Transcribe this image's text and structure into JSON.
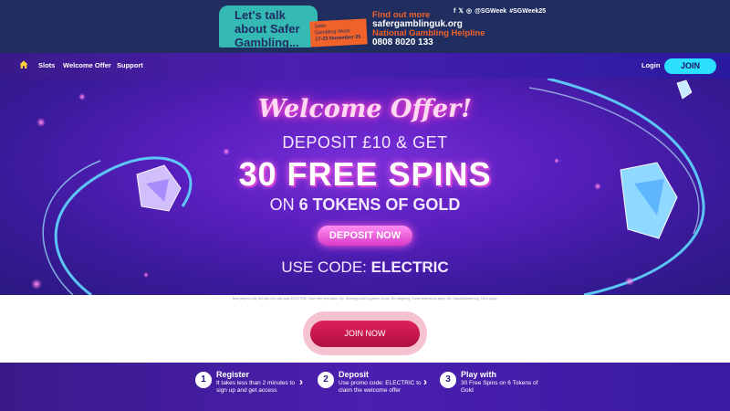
{
  "promo": {
    "bubble_text": "Let's talk about Safer Gambling...",
    "week_line1": "Safer",
    "week_line2": "Gambling Week",
    "week_dates": "17-23 November 25",
    "find_out": "Find out more",
    "site": "safergamblinguk.org",
    "helpline": "National Gambling Helpline",
    "phone": "0808 8020 133",
    "social_handle": "@SGWeek",
    "hashtag": "#SGWeek25",
    "social_icons": [
      "facebook-icon",
      "x-icon",
      "instagram-icon"
    ],
    "colors": {
      "navy": "#1f2e5f",
      "teal": "#35b9b4",
      "orange": "#f0622a"
    }
  },
  "nav": {
    "items": [
      {
        "label": "Slots"
      },
      {
        "label": "Welcome Offer"
      },
      {
        "label": "Support"
      }
    ],
    "login_label": "Login",
    "join_label": "JOIN",
    "home_icon": "home-icon",
    "colors": {
      "join_bg": "#2be0ff",
      "home": "#ffd23a"
    }
  },
  "hero": {
    "welcome": "Welcome Offer!",
    "deposit": "DEPOSIT £10 & GET",
    "spins": "30 FREE SPINS",
    "tokens_prefix": "ON ",
    "tokens_bold": "6 TOKENS OF GOLD",
    "deposit_button": "DEPOSIT NOW",
    "code_prefix": "USE CODE: ",
    "code": "ELECTRIC"
  },
  "terms": "New players only. Min dep £10 with code ELECTRIC. Each free spin value 10p. Winnings paid in games bonus. 30x wagering. Game restrictions apply. 18+ GambleAware.org. T&Cs apply.",
  "join_now": "JOIN NOW",
  "steps": [
    {
      "num": "1",
      "title": "Register",
      "desc": "It takes less than 2 minutes to sign up and get access"
    },
    {
      "num": "2",
      "title": "Deposit",
      "desc": "Use promo code: ELECTRIC to claim the welcome offer"
    },
    {
      "num": "3",
      "title": "Play with",
      "desc": "30 Free Spins on 6 Tokens of Gold"
    }
  ]
}
